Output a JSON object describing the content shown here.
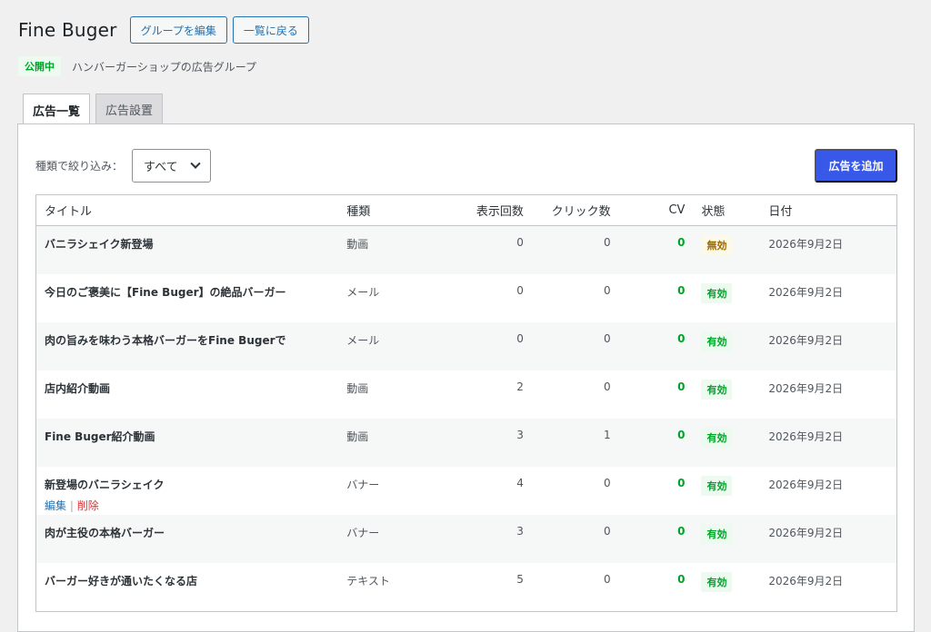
{
  "header": {
    "title": "Fine Buger",
    "edit_group_label": "グループを編集",
    "back_label": "一覧に戻る"
  },
  "meta": {
    "status": "公開中",
    "description": "ハンバーガーショップの広告グループ"
  },
  "tabs": [
    {
      "label": "広告一覧",
      "active": true
    },
    {
      "label": "広告設置",
      "active": false
    }
  ],
  "filter": {
    "label": "種類で絞り込み：",
    "selected": "すべて"
  },
  "add_button": "広告を追加",
  "table": {
    "columns": [
      "タイトル",
      "種類",
      "表示回数",
      "クリック数",
      "CV",
      "状態",
      "日付"
    ],
    "rows": [
      {
        "title": "バニラシェイク新登場",
        "type": "動画",
        "views": "0",
        "clicks": "0",
        "cv": "0",
        "status": "無効",
        "status_kind": "inactive",
        "date": "2026年9月2日"
      },
      {
        "title": "今日のご褒美に【Fine Buger】の絶品バーガー",
        "type": "メール",
        "views": "0",
        "clicks": "0",
        "cv": "0",
        "status": "有効",
        "status_kind": "active",
        "date": "2026年9月2日"
      },
      {
        "title": "肉の旨みを味わう本格バーガーをFine Bugerで",
        "type": "メール",
        "views": "0",
        "clicks": "0",
        "cv": "0",
        "status": "有効",
        "status_kind": "active",
        "date": "2026年9月2日"
      },
      {
        "title": "店内紹介動画",
        "type": "動画",
        "views": "2",
        "clicks": "0",
        "cv": "0",
        "status": "有効",
        "status_kind": "active",
        "date": "2026年9月2日"
      },
      {
        "title": "Fine Buger紹介動画",
        "type": "動画",
        "views": "3",
        "clicks": "1",
        "cv": "0",
        "status": "有効",
        "status_kind": "active",
        "date": "2026年9月2日"
      },
      {
        "title": "新登場のバニラシェイク",
        "type": "バナー",
        "views": "4",
        "clicks": "0",
        "cv": "0",
        "status": "有効",
        "status_kind": "active",
        "date": "2026年9月2日",
        "actions": {
          "edit": "編集",
          "separator": "|",
          "delete": "削除"
        }
      },
      {
        "title": "肉が主役の本格バーガー",
        "type": "バナー",
        "views": "3",
        "clicks": "0",
        "cv": "0",
        "status": "有効",
        "status_kind": "active",
        "date": "2026年9月2日"
      },
      {
        "title": "バーガー好きが通いたくなる店",
        "type": "テキスト",
        "views": "5",
        "clicks": "0",
        "cv": "0",
        "status": "有効",
        "status_kind": "active",
        "date": "2026年9月2日"
      }
    ]
  },
  "colors": {
    "accent": "#3858e9",
    "link": "#2271b1",
    "success": "#00a32a",
    "warning": "#996800",
    "danger": "#d63638"
  }
}
